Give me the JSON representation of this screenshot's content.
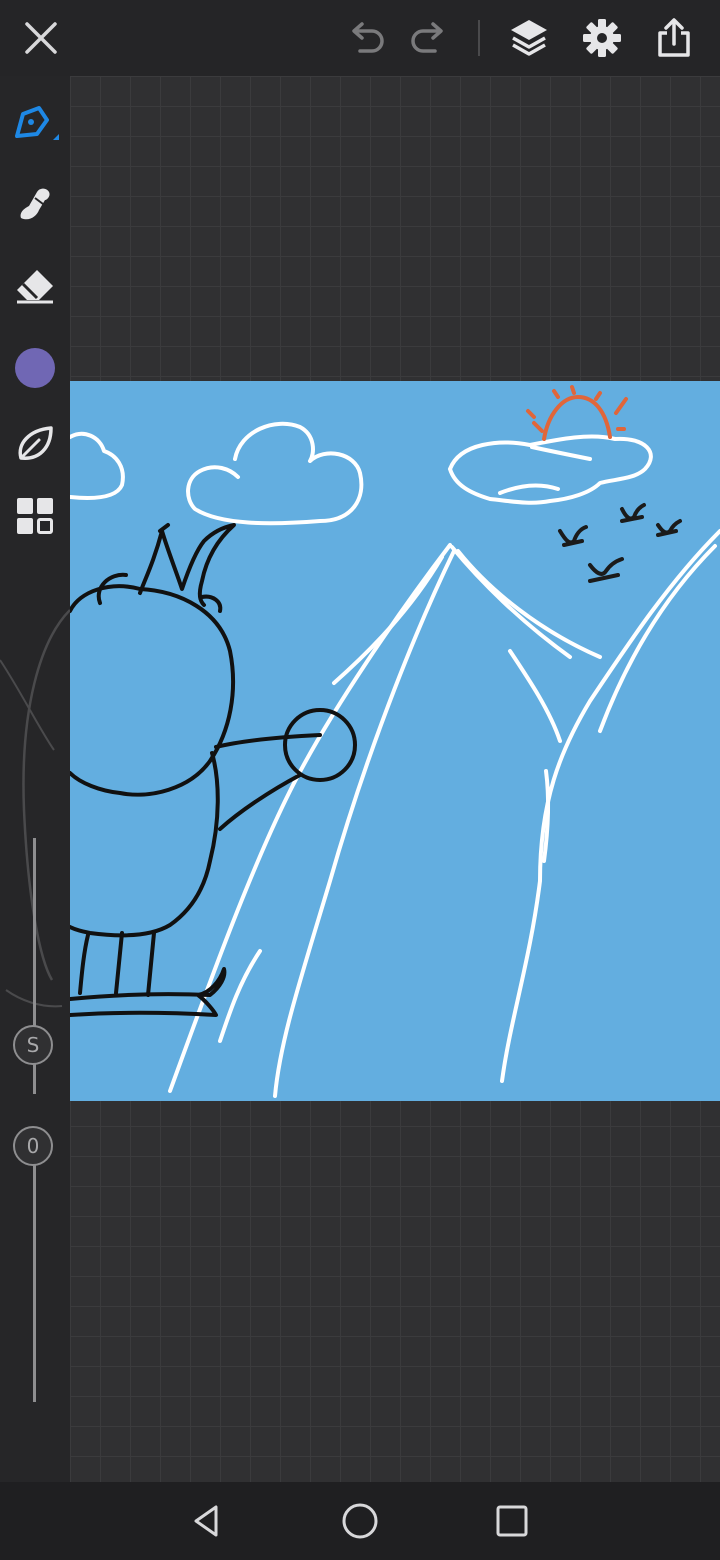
{
  "toolbar": {
    "close_icon": "close-icon",
    "undo_icon": "undo-icon",
    "redo_icon": "redo-icon",
    "layers_icon": "layers-icon",
    "settings_icon": "gear-icon",
    "export_icon": "share-icon"
  },
  "tools": [
    {
      "name": "brush",
      "icon": "brush-icon",
      "active": true
    },
    {
      "name": "smudge",
      "icon": "smudge-icon",
      "active": false
    },
    {
      "name": "eraser",
      "icon": "eraser-icon",
      "active": false
    },
    {
      "name": "color",
      "icon": "color-swatch",
      "active": false
    },
    {
      "name": "liquify",
      "icon": "leaf-icon",
      "active": false
    },
    {
      "name": "gallery",
      "icon": "grid-icon",
      "active": false
    }
  ],
  "sliders": {
    "size_label": "S",
    "opacity_label": "0"
  },
  "colors": {
    "accent": "#1e88e5",
    "current_color": "#7067b4",
    "canvas_background": "#63aee0",
    "sun": "#e0663a"
  },
  "nav": {
    "back_icon": "back-triangle-icon",
    "home_icon": "home-circle-icon",
    "recents_icon": "recents-square-icon"
  }
}
